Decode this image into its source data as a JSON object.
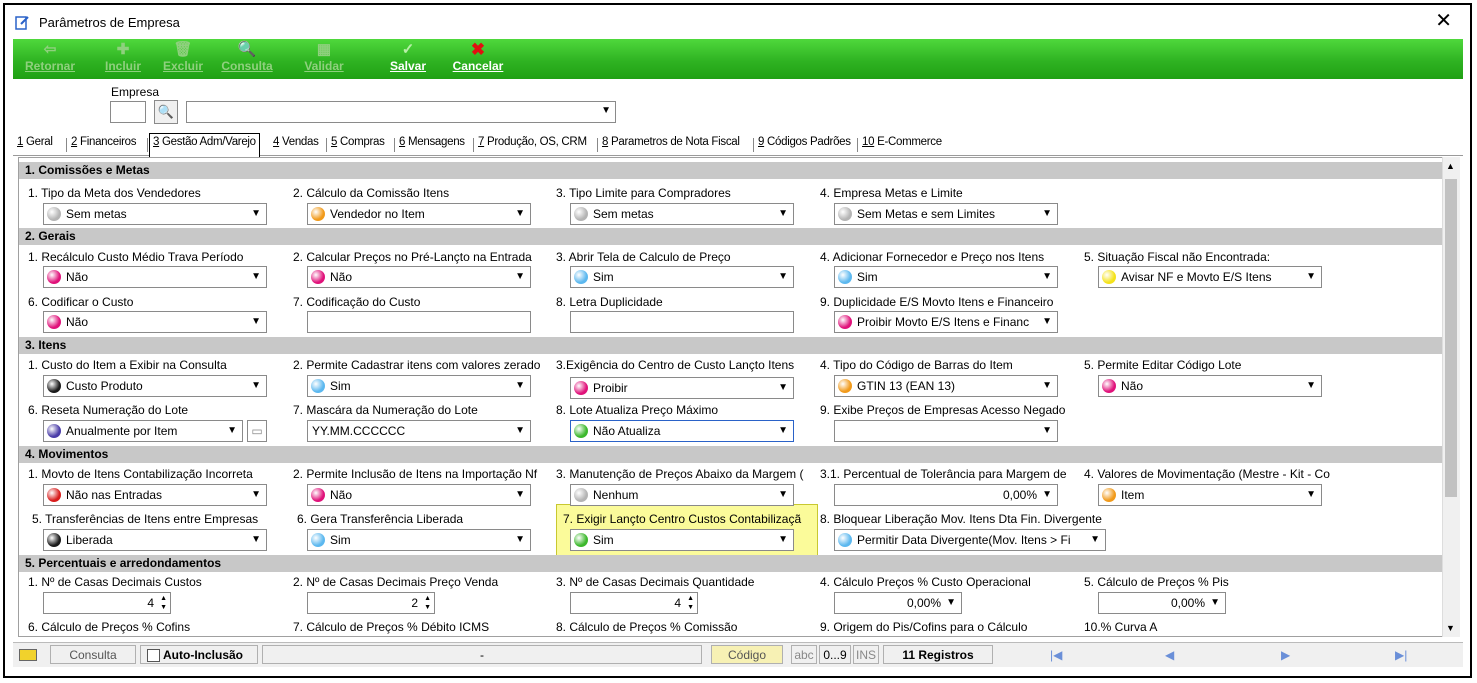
{
  "window": {
    "title": "Parâmetros de Empresa",
    "close": "✕"
  },
  "toolbar": {
    "buttons": [
      {
        "label": "Retornar",
        "icon": "⇦",
        "enabled": false
      },
      {
        "label": "Incluir",
        "icon": "✚",
        "enabled": false
      },
      {
        "label": "Excluir",
        "icon": "🗑",
        "enabled": false
      },
      {
        "label": "Consulta",
        "icon": "🔍",
        "enabled": false
      },
      {
        "label": "Validar",
        "icon": "▦",
        "enabled": false
      },
      {
        "label": "Salvar",
        "icon": "✓",
        "enabled": true
      },
      {
        "label": "Cancelar",
        "icon": "✖",
        "enabled": true
      }
    ]
  },
  "empresa": {
    "label": "Empresa",
    "code": "",
    "search_icon": "🔍",
    "name": ""
  },
  "tabs": [
    {
      "num": "1",
      "label": " Geral"
    },
    {
      "num": "2",
      "label": " Financeiros"
    },
    {
      "num": "3",
      "label": " Gestão Adm/Varejo"
    },
    {
      "num": "4",
      "label": " Vendas"
    },
    {
      "num": "5",
      "label": " Compras"
    },
    {
      "num": "6",
      "label": " Mensagens"
    },
    {
      "num": "7",
      "label": " Produção, OS, CRM"
    },
    {
      "num": "8",
      "label": " Parametros de Nota Fiscal"
    },
    {
      "num": "9",
      "label": " Códigos Padrões"
    },
    {
      "num": "10",
      "label": " E-Commerce"
    }
  ],
  "active_tab": "3 Gestão Adm/Varejo",
  "colors": {
    "gray": "#b4b4b4",
    "orange": "#f19a1a",
    "magenta": "#e0127a",
    "blue": "#5cb8ef",
    "yellow": "#f4e21a",
    "black": "#1a1a1a",
    "green": "#3cb82c",
    "purple": "#4a3ca8",
    "red": "#d81c1c"
  },
  "sections": {
    "s1": "1. Comissões e Metas",
    "s2": "2. Gerais",
    "s3": "3. Itens",
    "s4": "4. Movimentos",
    "s5": "5. Percentuais e arredondamentos"
  },
  "fields": {
    "f1_1": {
      "label": "1. Tipo da Meta dos Vendedores",
      "value": "Sem metas",
      "color": "gray"
    },
    "f1_2": {
      "label": "2. Cálculo da Comissão Itens",
      "value": "Vendedor no Item",
      "color": "orange"
    },
    "f1_3": {
      "label": "3. Tipo Limite para Compradores",
      "value": "Sem metas",
      "color": "gray"
    },
    "f1_4": {
      "label": "4. Empresa Metas e Limite",
      "value": "Sem Metas e sem Limites",
      "color": "gray"
    },
    "f2_1": {
      "label": "1. Recálculo Custo Médio Trava Período",
      "value": "Não",
      "color": "magenta"
    },
    "f2_2": {
      "label": "2. Calcular Preços no Pré-Lançto na Entrada",
      "value": "Não",
      "color": "magenta"
    },
    "f2_3": {
      "label": "3. Abrir Tela de Calculo de Preço",
      "value": "Sim",
      "color": "blue"
    },
    "f2_4": {
      "label": "4. Adicionar Fornecedor e Preço nos Itens",
      "value": "Sim",
      "color": "blue"
    },
    "f2_5": {
      "label": "5. Situação Fiscal não Encontrada:",
      "value": "Avisar NF e Movto E/S Itens",
      "color": "yellow"
    },
    "f2_6": {
      "label": "6. Codificar o Custo",
      "value": "Não",
      "color": "magenta"
    },
    "f2_7": {
      "label": "7. Codificação do Custo",
      "value": ""
    },
    "f2_8": {
      "label": "8. Letra Duplicidade",
      "value": ""
    },
    "f2_9": {
      "label": "9. Duplicidade E/S Movto Itens e Financeiro",
      "value": "Proibir Movto E/S Itens e Financ",
      "color": "magenta"
    },
    "f3_1": {
      "label": "1. Custo do Item a Exibir na Consulta",
      "value": "Custo Produto",
      "color": "black"
    },
    "f3_2": {
      "label": "2. Permite Cadastrar itens com valores zerado",
      "value": "Sim",
      "color": "blue"
    },
    "f3_3": {
      "label": "3.Exigência do Centro de Custo Lançto Itens",
      "value": "Proibir",
      "color": "magenta"
    },
    "f3_4": {
      "label": "4. Tipo do Código de Barras do Item",
      "value": "GTIN 13 (EAN 13)",
      "color": "orange"
    },
    "f3_5": {
      "label": "5. Permite Editar Código Lote",
      "value": "Não",
      "color": "magenta"
    },
    "f3_6": {
      "label": "6. Reseta Numeração do Lote",
      "value": "Anualmente por Item",
      "color": "purple"
    },
    "f3_7": {
      "label": "7. Mascára da Numeração do Lote",
      "value": "YY.MM.CCCCCC"
    },
    "f3_8": {
      "label": "8. Lote Atualiza Preço Máximo",
      "value": "Não Atualiza",
      "color": "green"
    },
    "f3_9": {
      "label": "9. Exibe Preços de Empresas Acesso Negado",
      "value": ""
    },
    "f4_1": {
      "label": "1. Movto de Itens Contabilização Incorreta",
      "value": "Não nas Entradas",
      "color": "red"
    },
    "f4_2": {
      "label": "2. Permite Inclusão de Itens na Importação Nf",
      "value": "Não",
      "color": "magenta"
    },
    "f4_3": {
      "label": "3. Manutenção de Preços Abaixo  da Margem (",
      "value": "Nenhum",
      "color": "gray"
    },
    "f4_31": {
      "label": "3.1. Percentual de Tolerância para Margem de",
      "value": "0,00%"
    },
    "f4_4": {
      "label": "4. Valores de Movimentação (Mestre - Kit - Co",
      "value": "Item",
      "color": "orange"
    },
    "f4_5": {
      "label": "5. Transferências  de Itens entre Empresas",
      "value": "Liberada",
      "color": "black"
    },
    "f4_6": {
      "label": "6. Gera Transferência Liberada",
      "value": "Sim",
      "color": "blue"
    },
    "f4_7": {
      "label": "7. Exigir Lançto Centro Custos Contabilizaçã",
      "value": "Sim",
      "color": "green"
    },
    "f4_8": {
      "label": "8. Bloquear Liberação Mov. Itens Dta Fin. Divergente",
      "value": "Permitir Data Divergente(Mov. Itens > Fi",
      "color": "blue"
    },
    "f5_1": {
      "label": "1. Nº de Casas Decimais Custos",
      "value": "4"
    },
    "f5_2": {
      "label": "2. Nº de Casas Decimais Preço Venda",
      "value": "2"
    },
    "f5_3": {
      "label": "3. Nº de Casas Decimais Quantidade",
      "value": "4"
    },
    "f5_4": {
      "label": "4. Cálculo Preços % Custo Operacional",
      "value": "0,00%"
    },
    "f5_5": {
      "label": "5. Cálculo de Preços % Pis",
      "value": "0,00%"
    },
    "f5_6": {
      "label": "6. Cálculo de Preços % Cofins",
      "value": ""
    },
    "f5_7": {
      "label": "7. Cálculo de Preços % Débito ICMS",
      "value": ""
    },
    "f5_8": {
      "label": "8. Cálculo de Preços % Comissão",
      "value": ""
    },
    "f5_9": {
      "label": "9. Origem do Pis/Cofins para o Cálculo",
      "value": ""
    },
    "f5_10": {
      "label": "10.% Curva A",
      "value": ""
    }
  },
  "statusbar": {
    "consulta": "Consulta",
    "auto_inclusao": "Auto-Inclusão",
    "dash": "-",
    "codigo": "Código",
    "abc": "abc",
    "num": "0...9",
    "ins": "INS",
    "registros": "11 Registros",
    "nav_first": "|◀",
    "nav_prev": "◀",
    "nav_next": "▶",
    "nav_last": "▶|"
  }
}
